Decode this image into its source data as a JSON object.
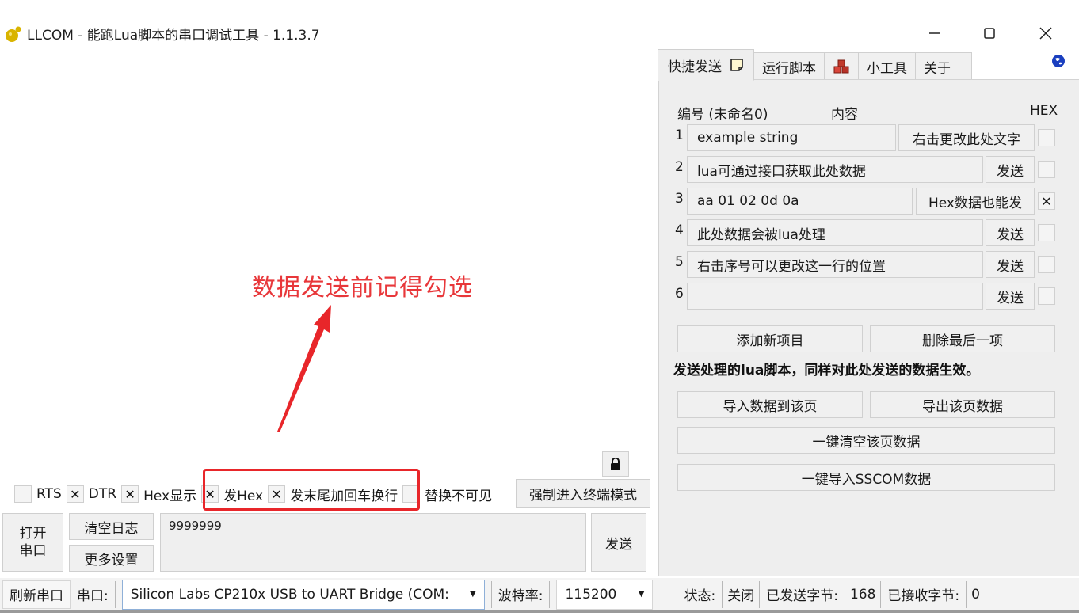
{
  "window": {
    "title": "LLCOM - 能跑Lua脚本的串口调试工具 - 1.1.3.7",
    "app_icon": "llcom-logo-icon",
    "controls": {
      "minimize": "—",
      "maximize": "☐",
      "close": "✕"
    }
  },
  "annotation": {
    "text": "数据发送前记得勾选",
    "color": "#e8373a"
  },
  "log_panel": {
    "lock_icon": "lock-icon"
  },
  "options": [
    {
      "label": "RTS",
      "checked": false
    },
    {
      "label": "DTR",
      "checked": true
    },
    {
      "label": "Hex显示",
      "checked": true
    },
    {
      "label": "发Hex",
      "checked": true
    },
    {
      "label": "发末尾加回车换行",
      "checked": true
    },
    {
      "label": "替换不可见",
      "checked": false
    }
  ],
  "check_mark": "✕",
  "force_terminal_button": "强制进入终端模式",
  "controls": {
    "open_port_line1": "打开",
    "open_port_line2": "串口",
    "clear_log": "清空日志",
    "more_settings": "更多设置",
    "send_input_value": "9999999",
    "send": "发送"
  },
  "statusbar": {
    "refresh_port": "刷新串口",
    "port_label": "串口:",
    "port_value": "Silicon Labs CP210x USB to UART Bridge (COM:",
    "baud_label": "波特率:",
    "baud_value": "115200",
    "state_label": "状态:",
    "state_value": "关闭",
    "sent_label": "已发送字节:",
    "sent_value": "168",
    "recv_label": "已接收字节:",
    "recv_value": "0"
  },
  "right_panel": {
    "tabs": [
      {
        "label": "快捷发送",
        "active": true,
        "icon": "note-icon"
      },
      {
        "label": "运行脚本",
        "active": false
      },
      {
        "label": "",
        "active": false,
        "icon": "cubes-icon"
      },
      {
        "label": "小工具",
        "active": false
      },
      {
        "label": "关于",
        "active": false
      }
    ],
    "globe_icon": "globe-icon",
    "header": {
      "number": "编号 (未命名0)",
      "content": "内容",
      "hex": "HEX"
    },
    "quick_rows": [
      {
        "num": "1",
        "value": "example string",
        "button": "右击更改此处文字",
        "hex": false
      },
      {
        "num": "2",
        "value": "lua可通过接口获取此处数据",
        "button": "发送",
        "hex": false
      },
      {
        "num": "3",
        "value": "aa 01 02 0d 0a",
        "button": "Hex数据也能发",
        "hex": true
      },
      {
        "num": "4",
        "value": "此处数据会被lua处理",
        "button": "发送",
        "hex": false
      },
      {
        "num": "5",
        "value": "右击序号可以更改这一行的位置",
        "button": "发送",
        "hex": false
      },
      {
        "num": "6",
        "value": "",
        "button": "发送",
        "hex": false
      }
    ],
    "add_item": "添加新项目",
    "delete_last": "删除最后一项",
    "hint": "发送处理的lua脚本，同样对此处发送的数据生效。",
    "import_page": "导入数据到该页",
    "export_page": "导出该页数据",
    "clear_page": "一键清空该页数据",
    "import_sscom": "一键导入SSCOM数据"
  }
}
